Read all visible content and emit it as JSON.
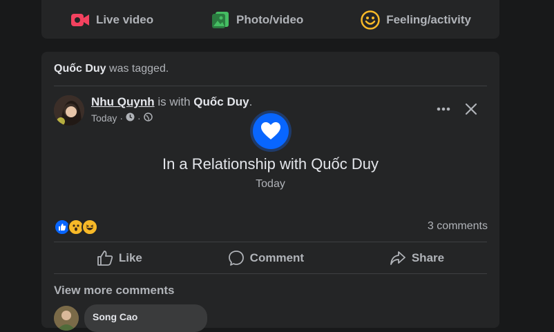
{
  "composer": {
    "live_video": "Live video",
    "photo_video": "Photo/video",
    "feeling_activity": "Feeling/activity"
  },
  "post": {
    "tag_user": "Quốc Duy",
    "tag_suffix": " was tagged.",
    "poster": "Nhu Quynh",
    "with_text": " is with ",
    "with_user": "Quốc Duy",
    "period": ".",
    "time": "Today",
    "life_event_title": "In a Relationship with Quốc Duy",
    "life_event_date": "Today",
    "comment_count": "3 comments",
    "actions": {
      "like": "Like",
      "comment": "Comment",
      "share": "Share"
    },
    "view_more": "View more comments",
    "first_comment_author": "Song Cao"
  },
  "colors": {
    "background": "#18191a",
    "card": "#242526",
    "primary_blue": "#0866ff",
    "live_red": "#f3425f",
    "photo_green": "#45bd62",
    "feeling_yellow": "#f7b928"
  },
  "icons": {
    "live": "video-camera-icon",
    "photo": "photo-icon",
    "feeling": "smile-icon",
    "heart": "heart-icon",
    "like": "thumb-up-icon",
    "comment": "speech-bubble-icon",
    "share": "share-arrow-icon"
  }
}
